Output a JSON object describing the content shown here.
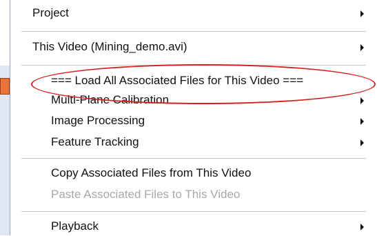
{
  "menu": {
    "items": [
      {
        "label": "Project",
        "submenu": true
      },
      {
        "label": "This Video (Mining_demo.avi)",
        "submenu": true
      },
      {
        "label": "=== Load All Associated Files for This Video ===",
        "submenu": false
      },
      {
        "label": "Multi-Plane Calibration",
        "submenu": true
      },
      {
        "label": "Image Processing",
        "submenu": true
      },
      {
        "label": "Feature Tracking",
        "submenu": true
      },
      {
        "label": "Copy Associated Files from This Video",
        "submenu": false
      },
      {
        "label": "Paste Associated Files to This Video",
        "submenu": false,
        "disabled": true
      },
      {
        "label": "Playback",
        "submenu": true
      }
    ]
  },
  "colors": {
    "annotation": "#d42020",
    "disabled_text": "#a8a8a8",
    "separator": "#c8c8c8"
  }
}
